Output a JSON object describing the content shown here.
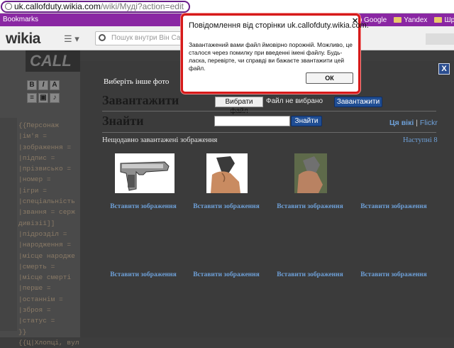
{
  "browser": {
    "url_host": "uk.callofduty.wikia.com",
    "url_path": "/wiki/Муді?action=edit",
    "bookmarks_label": "Bookmarks",
    "bookmark_items": [
      "Google",
      "Yandex",
      "Шрифт"
    ]
  },
  "header": {
    "logo": "wikia",
    "search_placeholder": "Пошук внутри Він Саll"
  },
  "editor": {
    "banner": "CALL",
    "code_lines": [
      "{{Персонаж",
      "|ім'я = ",
      "|зображення = ",
      "|підпис = ",
      "|прізвисько = ",
      "|номер = ",
      "|ігри = ",
      "|спеціальність",
      "|звання = серж",
      "дивізії]]",
      "|підрозділ = ",
      "|народження = ",
      "|місце народже",
      "|смерть = ",
      "|місце смерті ",
      "|перше = ",
      "|останнім = ",
      "|зброя = ",
      "|статус = ",
      "}}",
      "",
      "{{Ц|Хлопці, вул"
    ]
  },
  "modal": {
    "close_label": "X",
    "choose_other": "Виберіть інше фото",
    "upload_title": "Завантажити",
    "choose_file": "Вибрати файл",
    "no_file": "Файл не вибрано",
    "upload_button": "Завантажити",
    "find_title": "Знайти",
    "find_button": "Знайти",
    "source_wiki": "Ця вікі",
    "source_sep": "|",
    "source_flickr": "Flickr",
    "recent_label": "Нещодавно завантажені зображення",
    "next_link": "Наступні 8",
    "insert_labels": [
      "Вставити зображення",
      "Вставити зображення",
      "Вставити зображення",
      "Вставити зображення",
      "Вставити зображення",
      "Вставити зображення",
      "Вставити зображення",
      "Вставити зображення"
    ]
  },
  "alert": {
    "title": "Повідомлення від сторінки uk.callofduty.wikia.com:",
    "message": "Завантажений вами файл ймовірно порожній. Можливо, це сталося через помилку при введенні імені файлу. Будь-ласка, перевірте, чи справді ви бажаєте звантажити цей файл.",
    "ok_label": "ОК"
  }
}
